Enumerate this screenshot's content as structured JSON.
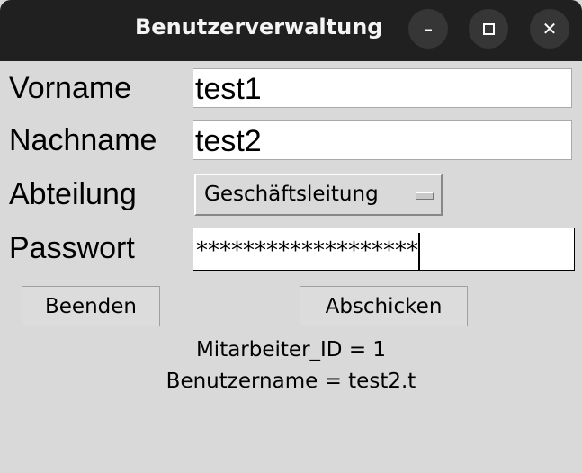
{
  "window": {
    "title": "Benutzerverwaltung",
    "minimize_icon": "minimize-icon",
    "maximize_icon": "maximize-icon",
    "close_icon": "close-icon"
  },
  "form": {
    "vorname": {
      "label": "Vorname",
      "value": "test1"
    },
    "nachname": {
      "label": "Nachname",
      "value": "test2"
    },
    "abteilung": {
      "label": "Abteilung",
      "value": "Geschäftsleitung"
    },
    "passwort": {
      "label": "Passwort",
      "value": "*******************"
    }
  },
  "buttons": {
    "quit": "Beenden",
    "submit": "Abschicken"
  },
  "info": {
    "id_line": "Mitarbeiter_ID = 1",
    "user_line": "Benutzername = test2.t"
  }
}
